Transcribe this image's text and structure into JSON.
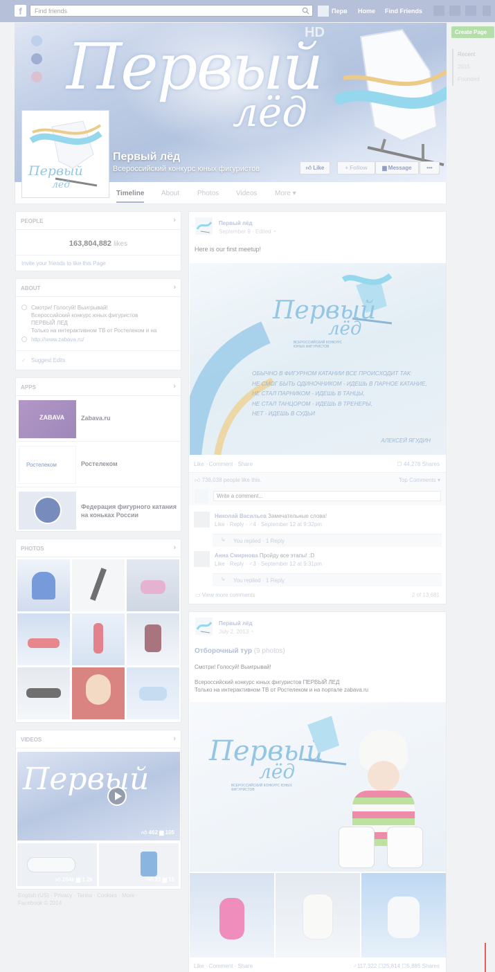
{
  "topbar": {
    "logo": "f",
    "search_placeholder": "Find friends",
    "profile_short": "Перв",
    "nav": [
      "Home",
      "Find Friends"
    ]
  },
  "sidebar_right": {
    "create_page": "Create Page",
    "timeline_nav": [
      "Recent",
      "2015",
      "Founded"
    ]
  },
  "cover": {
    "title_line1": "Первый",
    "title_line2": "лёд",
    "hd": "HD",
    "page_name": "Первый лёд",
    "category": "Всероссийский конкурс юных фигуристов",
    "buttons": {
      "like": "Like",
      "follow": "Follow",
      "message": "Message",
      "more": "•••"
    }
  },
  "tabs": [
    "Timeline",
    "About",
    "Photos",
    "Videos",
    "More"
  ],
  "people": {
    "header": "PEOPLE",
    "count": "163,804,882",
    "likes_label": "likes",
    "invite": "Invite your friends to like this Page"
  },
  "about": {
    "header": "ABOUT",
    "lines": [
      "Смотри! Голосуй! Выигрывай!",
      "Всероссийский конкурс юных фигуристов",
      "ПЕРВЫЙ ЛЕД",
      "Только на интерактивном ТВ от Ростелеком и на"
    ],
    "url": "http://www.zabava.ru/",
    "suggest": "Suggest Edits"
  },
  "apps": {
    "header": "APPS",
    "items": [
      {
        "name": "Zabava.ru",
        "thumb_text": "ZABAVA"
      },
      {
        "name": "Ростелеком",
        "thumb_text": "Ростелеком"
      },
      {
        "name": "Федерация фигурного катания на коньках России",
        "thumb_text": ""
      }
    ]
  },
  "photos": {
    "header": "PHOTOS"
  },
  "videos": {
    "header": "VIDEOS",
    "main_likes": "462",
    "main_comments": "105",
    "v2_likes": "204k",
    "v2_comments": "1.2k",
    "v3_likes": "23",
    "v3_comments": "15"
  },
  "footer": {
    "links": "English (US) · Privacy · Terms · Cookies · More ·",
    "copyright": "Facebook © 2014"
  },
  "post1": {
    "author": "Первый лёд",
    "date": "September 9 · Edited",
    "text": "Here is our first meetup!",
    "image_title1": "Первый",
    "image_title2": "лёд",
    "image_subtitle": "ВСЕРОССИЙСКИЙ КОНКУРС ЮНЫХ ФИГУРИСТОВ",
    "quote": [
      "ОБЫЧНО В ФИГУРНОМ КАТАНИИ ВСЕ ПРОИСХОДИТ ТАК:",
      "НЕ СМОГ БЫТЬ ОДИНОЧНИКОМ - ИДЕШЬ В ПАРНОЕ КАТАНИЕ,",
      "НЕ СТАЛ ПАРНИКОМ - ИДЕШЬ В ТАНЦЫ,",
      "НЕ СТАЛ ТАНЦОРОМ - ИДЕШЬ В ТРЕНЕРЫ,",
      "НЕТ - ИДЕШЬ В СУДЬИ"
    ],
    "quote_author": "АЛЕКСЕЙ ЯГУДИН",
    "actions": "Like · Comment · Share",
    "shares": "44,278 Shares",
    "likes_line": "738,038 people like this.",
    "top_comments": "Top Comments ▾",
    "write_placeholder": "Write a comment...",
    "comments": [
      {
        "name": "Николай Васильев",
        "text": "Замечательные слова!",
        "meta": "Like · Reply · ♂4 · September 12 at 9:32pm",
        "reply": "You replied · 1 Reply"
      },
      {
        "name": "Анна Смирнова",
        "text": "Пройду все этапы! :D",
        "meta": "Like · Reply · ♂3 · September 12 at 9:31pm",
        "reply": "You replied · 1 Reply"
      }
    ],
    "view_more": "View more comments",
    "pager": "2 of 13,681"
  },
  "post2": {
    "author": "Первый лёд",
    "date": "July 2, 2013",
    "album_title": "Отборочный тур",
    "album_count": "(9 photos)",
    "text1": "Смотри! Голосуй! Выигрывай!",
    "text2": "Всероссийский конкурс юных фигуристов ПЕРВЫЙ ЛЕД",
    "text3": "Только на интерактивном ТВ от Ростелеком и на портале  zabava.ru",
    "image_title1": "Первый",
    "image_title2": "лёд",
    "image_subtitle": "ВСЕРОССИЙСКИЙ КОНКУРС ЮНЫХ ФИГУРИСТОВ",
    "actions": "Like · Comment · Share",
    "stats": "♂117,322  ☐25,814  ☐5,885 Shares"
  }
}
